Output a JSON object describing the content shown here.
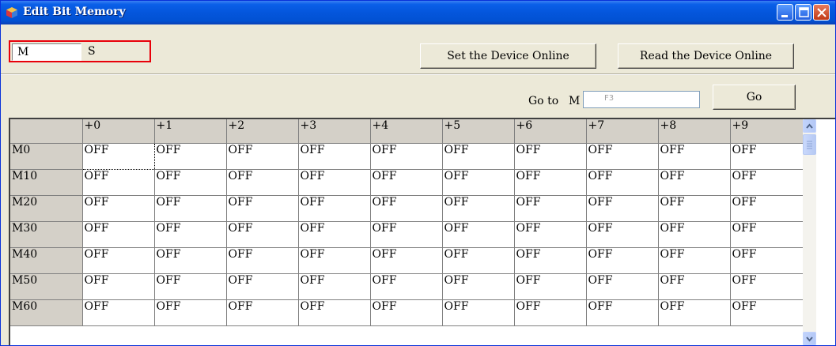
{
  "window": {
    "title": "Edit Bit Memory",
    "icon": "cube-icon"
  },
  "tabs": [
    {
      "label": "M",
      "selected": true
    },
    {
      "label": "S",
      "selected": false
    }
  ],
  "buttons": {
    "set_online": "Set the Device Online",
    "read_online": "Read the Device Online",
    "go": "Go"
  },
  "goto": {
    "label": "Go to",
    "prefix": "M",
    "value": "F3"
  },
  "grid": {
    "columns": [
      "+0",
      "+1",
      "+2",
      "+3",
      "+4",
      "+5",
      "+6",
      "+7",
      "+8",
      "+9"
    ],
    "rows": [
      {
        "label": "M0",
        "values": [
          "OFF",
          "OFF",
          "OFF",
          "OFF",
          "OFF",
          "OFF",
          "OFF",
          "OFF",
          "OFF",
          "OFF"
        ]
      },
      {
        "label": "M10",
        "values": [
          "OFF",
          "OFF",
          "OFF",
          "OFF",
          "OFF",
          "OFF",
          "OFF",
          "OFF",
          "OFF",
          "OFF"
        ]
      },
      {
        "label": "M20",
        "values": [
          "OFF",
          "OFF",
          "OFF",
          "OFF",
          "OFF",
          "OFF",
          "OFF",
          "OFF",
          "OFF",
          "OFF"
        ]
      },
      {
        "label": "M30",
        "values": [
          "OFF",
          "OFF",
          "OFF",
          "OFF",
          "OFF",
          "OFF",
          "OFF",
          "OFF",
          "OFF",
          "OFF"
        ]
      },
      {
        "label": "M40",
        "values": [
          "OFF",
          "OFF",
          "OFF",
          "OFF",
          "OFF",
          "OFF",
          "OFF",
          "OFF",
          "OFF",
          "OFF"
        ]
      },
      {
        "label": "M50",
        "values": [
          "OFF",
          "OFF",
          "OFF",
          "OFF",
          "OFF",
          "OFF",
          "OFF",
          "OFF",
          "OFF",
          "OFF"
        ]
      },
      {
        "label": "M60",
        "values": [
          "OFF",
          "OFF",
          "OFF",
          "OFF",
          "OFF",
          "OFF",
          "OFF",
          "OFF",
          "OFF",
          "OFF"
        ]
      }
    ]
  },
  "colors": {
    "titlebar": "#0456dc",
    "highlight_border": "#e8000a",
    "header_bg": "#d4d0c8"
  }
}
